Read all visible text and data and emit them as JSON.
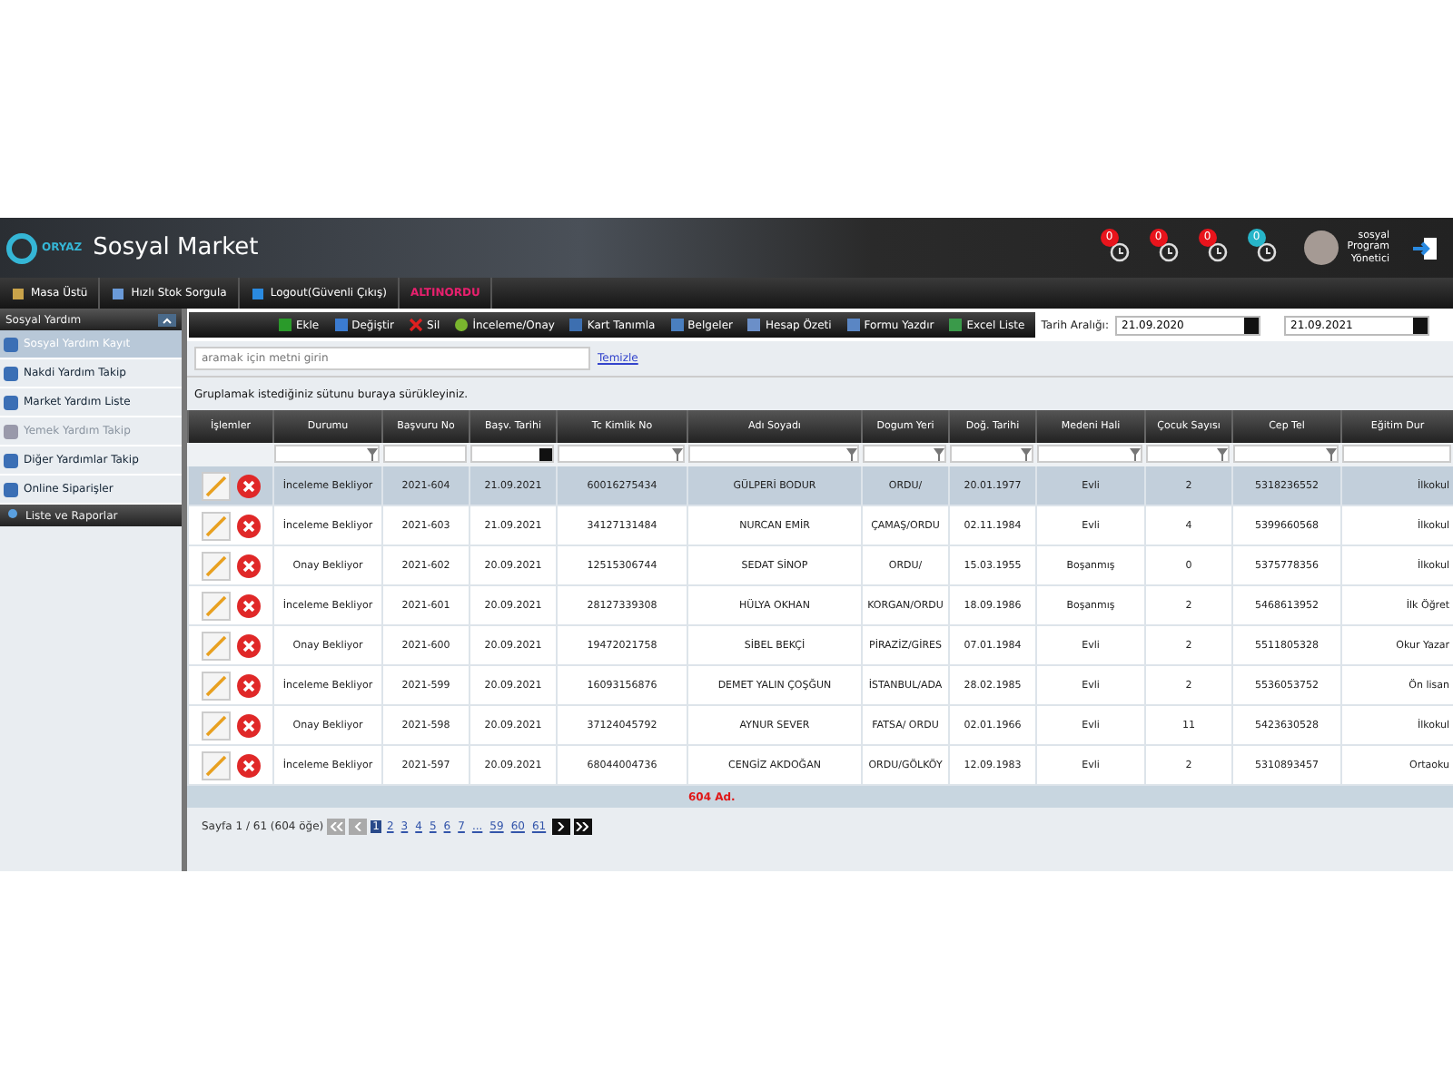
{
  "header": {
    "logo": "ORYAZ",
    "title": "Sosyal Market",
    "notifications": [
      {
        "count": "0",
        "color": "#e8141c"
      },
      {
        "count": "0",
        "color": "#e8141c"
      },
      {
        "count": "0",
        "color": "#e8141c"
      },
      {
        "count": "0",
        "color": "#27b5c9"
      }
    ],
    "user": [
      "sosyal",
      "Program",
      "Yönetici"
    ]
  },
  "nav": [
    {
      "label": "Masa Üstü",
      "kind": "home"
    },
    {
      "label": "Hızlı Stok Sorgula",
      "kind": "stock"
    },
    {
      "label": "Logout(Güvenli Çıkış)",
      "kind": "logout"
    },
    {
      "label": "ALTINORDU",
      "kind": "brand"
    }
  ],
  "sidebar": {
    "title": "Sosyal Yardım",
    "items": [
      {
        "label": "Sosyal Yardım Kayıt",
        "selected": true,
        "disabled": false
      },
      {
        "label": "Nakdi Yardım Takip",
        "selected": false,
        "disabled": false
      },
      {
        "label": "Market Yardım Liste",
        "selected": false,
        "disabled": false
      },
      {
        "label": "Yemek Yardım Takip",
        "selected": false,
        "disabled": true
      },
      {
        "label": "Diğer Yardımlar Takip",
        "selected": false,
        "disabled": false
      },
      {
        "label": "Online Siparişler",
        "selected": false,
        "disabled": false
      }
    ],
    "section": "Liste ve Raporlar"
  },
  "toolbar": [
    {
      "label": "Ekle",
      "kind": "add"
    },
    {
      "label": "Değiştir",
      "kind": "edit"
    },
    {
      "label": "Sil",
      "kind": "delete"
    },
    {
      "label": "İnceleme/Onay",
      "kind": "approve"
    },
    {
      "label": "Kart Tanımla",
      "kind": "card"
    },
    {
      "label": "Belgeler",
      "kind": "docs"
    },
    {
      "label": "Hesap Özeti",
      "kind": "sheet"
    },
    {
      "label": "Formu Yazdır",
      "kind": "print"
    },
    {
      "label": "Excel Liste",
      "kind": "excel"
    }
  ],
  "date_range": {
    "label": "Tarih Aralığı:",
    "from": "21.09.2020",
    "to": "21.09.2021"
  },
  "search": {
    "placeholder": "aramak için metni girin",
    "clear": "Temizle"
  },
  "group_hint": "Gruplamak istediğiniz sütunu buraya sürükleyiniz.",
  "table": {
    "columns": [
      {
        "label": "İşlemler",
        "kind": "none"
      },
      {
        "label": "Durumu",
        "kind": "funnel"
      },
      {
        "label": "Başvuru No",
        "kind": "plain"
      },
      {
        "label": "Başv. Tarihi",
        "kind": "date"
      },
      {
        "label": "Tc Kimlik No",
        "kind": "funnel"
      },
      {
        "label": "Adı Soyadı",
        "kind": "funnel"
      },
      {
        "label": "Dogum Yeri",
        "kind": "funnel"
      },
      {
        "label": "Doğ. Tarihi",
        "kind": "funnel"
      },
      {
        "label": "Medeni Hali",
        "kind": "funnel"
      },
      {
        "label": "Çocuk Sayısı",
        "kind": "funnel"
      },
      {
        "label": "Cep Tel",
        "kind": "funnel"
      },
      {
        "label": "Eğitim Dur",
        "kind": "plain"
      }
    ],
    "rows": [
      {
        "selected": true,
        "cells": [
          "",
          "İnceleme Bekliyor",
          "2021-604",
          "21.09.2021",
          "60016275434",
          "GÜLPERİ BODUR",
          "ORDU/",
          "20.01.1977",
          "Evli",
          "2",
          "5318236552",
          "İlkokul"
        ]
      },
      {
        "selected": false,
        "cells": [
          "",
          "İnceleme Bekliyor",
          "2021-603",
          "21.09.2021",
          "34127131484",
          "NURCAN EMİR",
          "ÇAMAŞ/ORDU",
          "02.11.1984",
          "Evli",
          "4",
          "5399660568",
          "İlkokul"
        ]
      },
      {
        "selected": false,
        "cells": [
          "",
          "Onay Bekliyor",
          "2021-602",
          "20.09.2021",
          "12515306744",
          "SEDAT SİNOP",
          "ORDU/",
          "15.03.1955",
          "Boşanmış",
          "0",
          "5375778356",
          "İlkokul"
        ]
      },
      {
        "selected": false,
        "cells": [
          "",
          "İnceleme Bekliyor",
          "2021-601",
          "20.09.2021",
          "28127339308",
          "HÜLYA OKHAN",
          "KORGAN/ORDU",
          "18.09.1986",
          "Boşanmış",
          "2",
          "5468613952",
          "İlk Öğret"
        ]
      },
      {
        "selected": false,
        "cells": [
          "",
          "Onay Bekliyor",
          "2021-600",
          "20.09.2021",
          "19472021758",
          "SİBEL BEKÇİ",
          "PİRAZİZ/GİRES",
          "07.01.1984",
          "Evli",
          "2",
          "5511805328",
          "Okur Yazar"
        ]
      },
      {
        "selected": false,
        "cells": [
          "",
          "İnceleme Bekliyor",
          "2021-599",
          "20.09.2021",
          "16093156876",
          "DEMET YALIN ÇOŞĞUN",
          "İSTANBUL/ADA",
          "28.02.1985",
          "Evli",
          "2",
          "5536053752",
          "Ön lisan"
        ]
      },
      {
        "selected": false,
        "cells": [
          "",
          "Onay Bekliyor",
          "2021-598",
          "20.09.2021",
          "37124045792",
          "AYNUR SEVER",
          "FATSA/ ORDU",
          "02.01.1966",
          "Evli",
          "11",
          "5423630528",
          "İlkokul"
        ]
      },
      {
        "selected": false,
        "cells": [
          "",
          "İnceleme Bekliyor",
          "2021-597",
          "20.09.2021",
          "68044004736",
          "CENGİZ AKDOĞAN",
          "ORDU/GÖLKÖY",
          "12.09.1983",
          "Evli",
          "2",
          "5310893457",
          "Ortaoku"
        ]
      }
    ],
    "total": "604 Ad."
  },
  "pager": {
    "summary": "Sayfa 1 / 61 (604 öğe)",
    "pages": [
      {
        "label": "1",
        "selected": true
      },
      {
        "label": "2",
        "selected": false
      },
      {
        "label": "3",
        "selected": false
      },
      {
        "label": "4",
        "selected": false
      },
      {
        "label": "5",
        "selected": false
      },
      {
        "label": "6",
        "selected": false
      },
      {
        "label": "7",
        "selected": false
      },
      {
        "label": "...",
        "selected": false
      },
      {
        "label": "59",
        "selected": false
      },
      {
        "label": "60",
        "selected": false
      },
      {
        "label": "61",
        "selected": false
      }
    ]
  }
}
